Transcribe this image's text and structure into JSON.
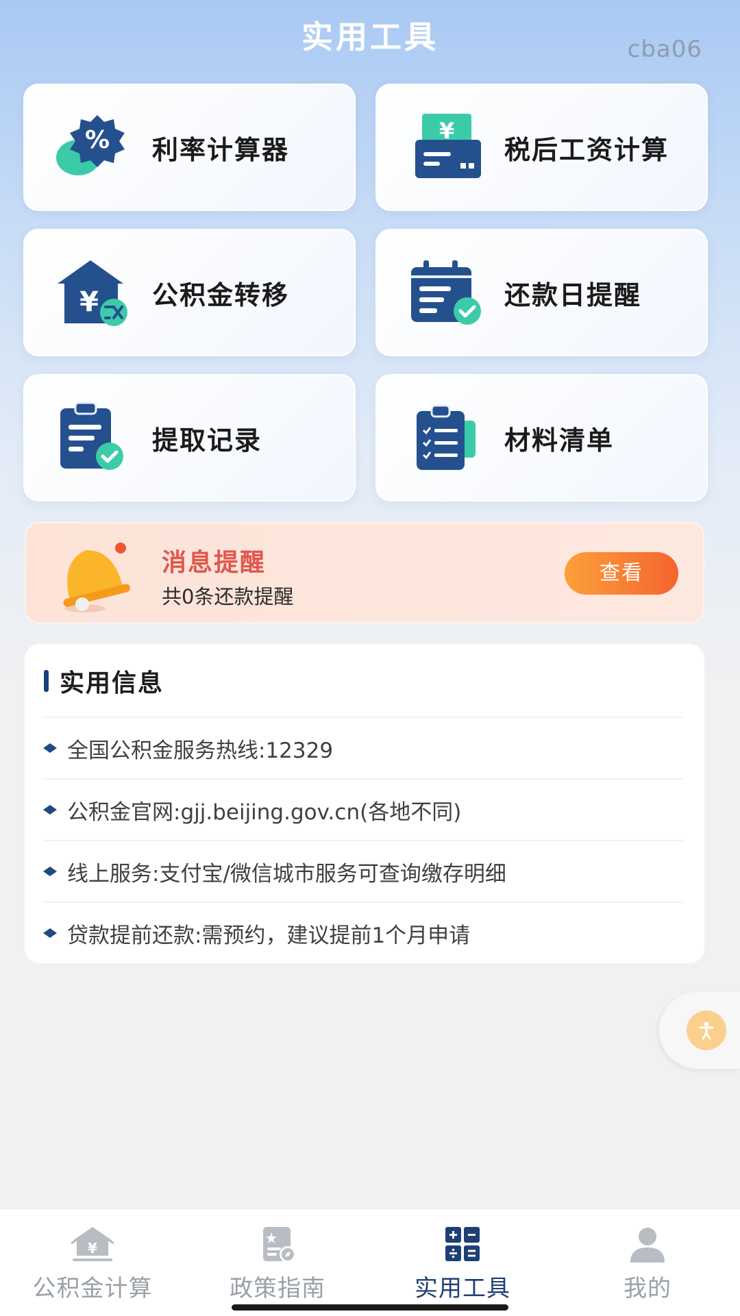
{
  "header": {
    "title": "实用工具",
    "watermark": "cba06"
  },
  "tools": [
    {
      "label": "利率计算器",
      "icon": "percent-badge-icon"
    },
    {
      "label": "税后工资计算",
      "icon": "salary-payment-icon"
    },
    {
      "label": "公积金转移",
      "icon": "house-fund-transfer-icon"
    },
    {
      "label": "还款日提醒",
      "icon": "calendar-check-icon"
    },
    {
      "label": "提取记录",
      "icon": "clipboard-check-icon"
    },
    {
      "label": "材料清单",
      "icon": "checklist-clipboard-icon"
    }
  ],
  "notice": {
    "title": "消息提醒",
    "subtitle": "共0条还款提醒",
    "button": "查看",
    "icon": "bell-icon"
  },
  "info": {
    "title": "实用信息",
    "items": [
      "全国公积金服务热线:12329",
      "公积金官网:gjj.beijing.gov.cn(各地不同)",
      "线上服务:支付宝/微信城市服务可查询缴存明细",
      "贷款提前还款:需预约，建议提前1个月申请"
    ]
  },
  "tabbar": [
    {
      "label": "公积金计算",
      "icon": "house-yuan-icon",
      "active": false
    },
    {
      "label": "政策指南",
      "icon": "policy-guide-icon",
      "active": false
    },
    {
      "label": "实用工具",
      "icon": "calculator-icon",
      "active": true
    },
    {
      "label": "我的",
      "icon": "user-icon",
      "active": false
    }
  ],
  "colors": {
    "brand_navy": "#17407a",
    "accent_teal": "#3ccba8",
    "notice_title": "#e0574d",
    "button_orange": "#f5642f"
  }
}
